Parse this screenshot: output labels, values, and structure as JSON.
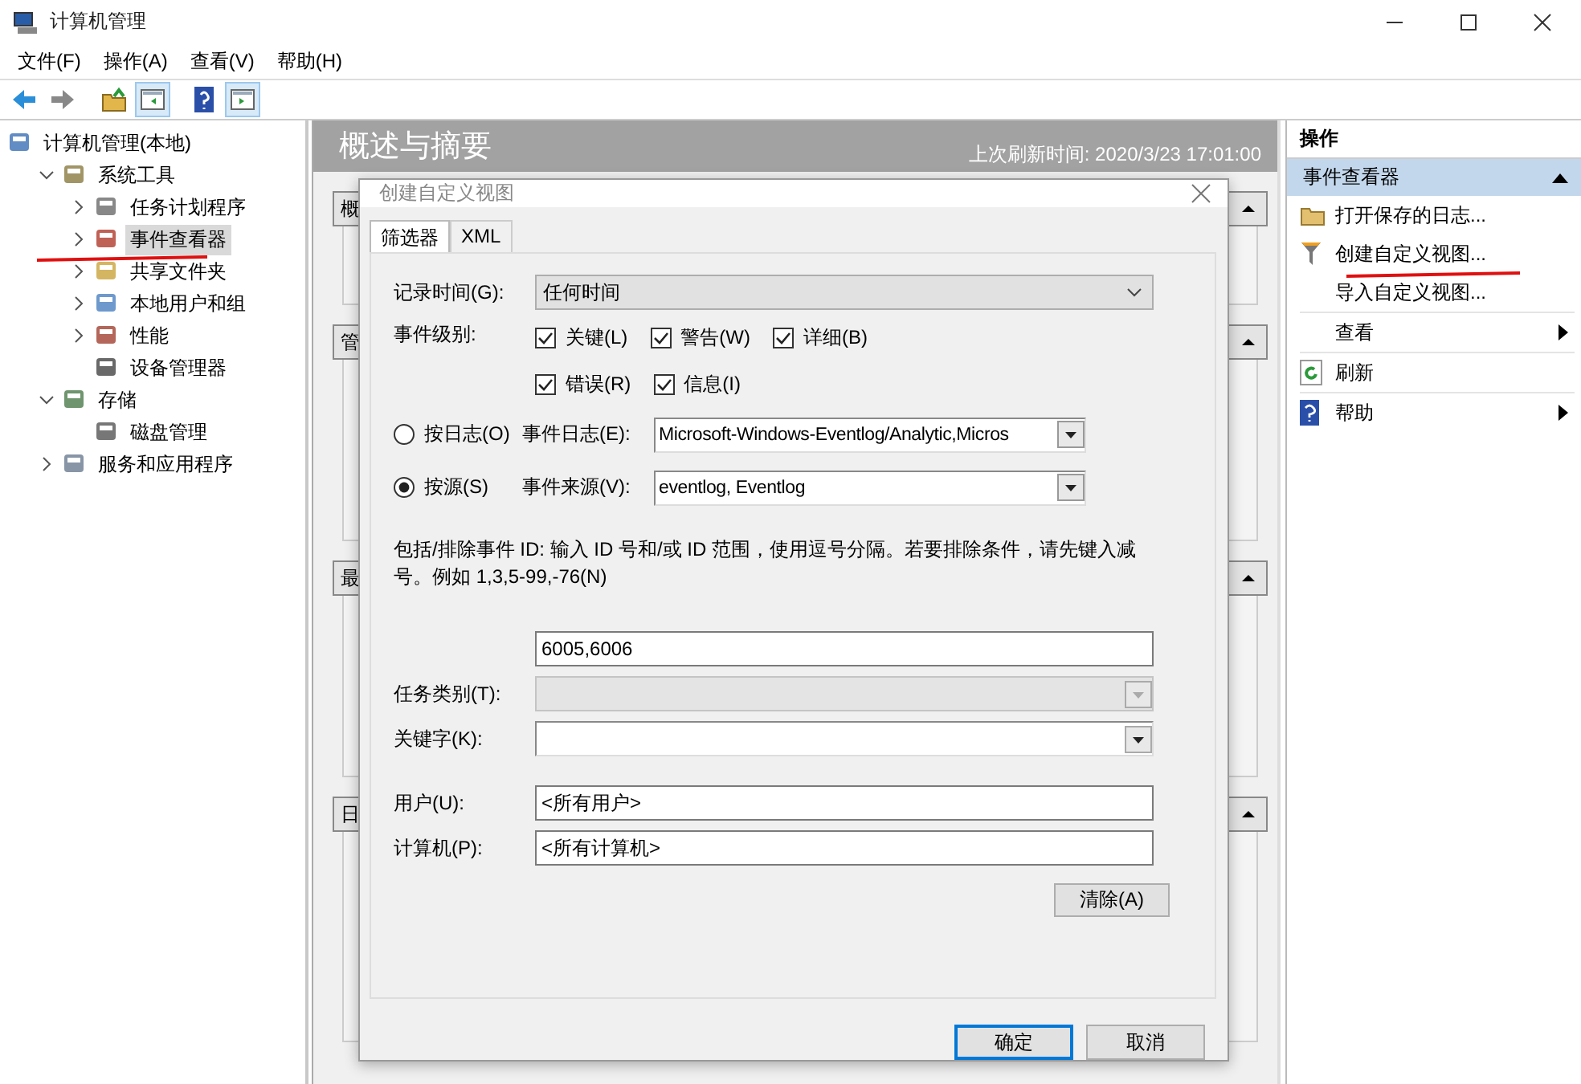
{
  "window": {
    "title": "计算机管理"
  },
  "menu": [
    "文件(F)",
    "操作(A)",
    "查看(V)",
    "帮助(H)"
  ],
  "toolbar": [
    {
      "pressed": false
    },
    {
      "pressed": false
    },
    {
      "pressed": false
    },
    {
      "pressed": true
    },
    {
      "pressed": false
    },
    {
      "pressed": true
    }
  ],
  "tree": [
    {
      "label": "计算机管理(本地)",
      "kind": "root",
      "selected": false,
      "children": [
        {
          "label": "系统工具",
          "kind": "branch",
          "expanded": true,
          "selected": false,
          "underlined": false,
          "children": [
            {
              "label": "任务计划程序",
              "kind": "branch",
              "expanded": false,
              "selected": false,
              "underlined": false
            },
            {
              "label": "事件查看器",
              "kind": "branch",
              "expanded": false,
              "selected": true,
              "underlined": true
            },
            {
              "label": "共享文件夹",
              "kind": "branch",
              "expanded": false,
              "selected": false,
              "underlined": false
            },
            {
              "label": "本地用户和组",
              "kind": "branch",
              "expanded": false,
              "selected": false,
              "underlined": false
            },
            {
              "label": "性能",
              "kind": "branch",
              "expanded": false,
              "selected": false,
              "underlined": false
            },
            {
              "label": "设备管理器",
              "kind": "leaf",
              "selected": false,
              "underlined": false
            }
          ]
        },
        {
          "label": "存储",
          "kind": "branch",
          "expanded": true,
          "selected": false,
          "underlined": false,
          "children": [
            {
              "label": "磁盘管理",
              "kind": "leaf",
              "selected": false,
              "underlined": false
            }
          ]
        },
        {
          "label": "服务和应用程序",
          "kind": "branch",
          "expanded": false,
          "selected": false,
          "underlined": false
        }
      ]
    }
  ],
  "center": {
    "title": "概述与摘要",
    "refreshed": "上次刷新时间: 2020/3/23 17:01:00",
    "sections": [
      "概",
      "管",
      "最",
      "日"
    ]
  },
  "dialog": {
    "title": "创建自定义视图",
    "tabs": [
      {
        "label": "筛选器",
        "selected": true
      },
      {
        "label": "XML",
        "selected": false
      }
    ],
    "logged": {
      "label": "记录时间(G):",
      "value": "任何时间"
    },
    "level_label": "事件级别:",
    "levels": [
      [
        {
          "label": "关键(L)",
          "checked": true
        },
        {
          "label": "警告(W)",
          "checked": true
        },
        {
          "label": "详细(B)",
          "checked": true
        }
      ],
      [
        {
          "label": "错误(R)",
          "checked": true
        },
        {
          "label": "信息(I)",
          "checked": true
        }
      ]
    ],
    "sources": [
      {
        "radio": "按日志(O)",
        "selected": false,
        "label": "事件日志(E):",
        "value": "Microsoft-Windows-Eventlog/Analytic,Micros"
      },
      {
        "radio": "按源(S)",
        "selected": true,
        "label": "事件来源(V):",
        "value": "eventlog, Eventlog"
      }
    ],
    "id_hint": "包括/排除事件 ID: 输入 ID 号和/或 ID 范围，使用逗号分隔。若要排除条件，请先键入减号。例如 1,3,5-99,-76(N)",
    "ids": "6005,6006",
    "fields": [
      {
        "label": "任务类别(T):",
        "kind": "combo",
        "disabled": true
      },
      {
        "label": "关键字(K):",
        "kind": "combo",
        "disabled": false
      },
      {
        "label": "用户(U):",
        "kind": "text",
        "value": "<所有用户>",
        "disabled": false
      },
      {
        "label": "计算机(P):",
        "kind": "text",
        "value": "<所有计算机>",
        "disabled": false
      }
    ],
    "clear": "清除(A)",
    "buttons": [
      {
        "label": "确定",
        "default": true
      },
      {
        "label": "取消",
        "default": false
      }
    ]
  },
  "actions": {
    "title": "操作",
    "group": "事件查看器",
    "items": [
      {
        "label": "打开保存的日志...",
        "submenu": false,
        "underlined": false,
        "divider": false
      },
      {
        "label": "创建自定义视图...",
        "submenu": false,
        "underlined": true,
        "divider": false
      },
      {
        "label": "导入自定义视图...",
        "submenu": false,
        "underlined": false,
        "divider": true
      },
      {
        "label": "查看",
        "submenu": true,
        "underlined": false,
        "divider": true
      },
      {
        "label": "刷新",
        "submenu": false,
        "underlined": false,
        "divider": true
      },
      {
        "label": "帮助",
        "submenu": true,
        "underlined": false,
        "divider": false
      }
    ]
  }
}
